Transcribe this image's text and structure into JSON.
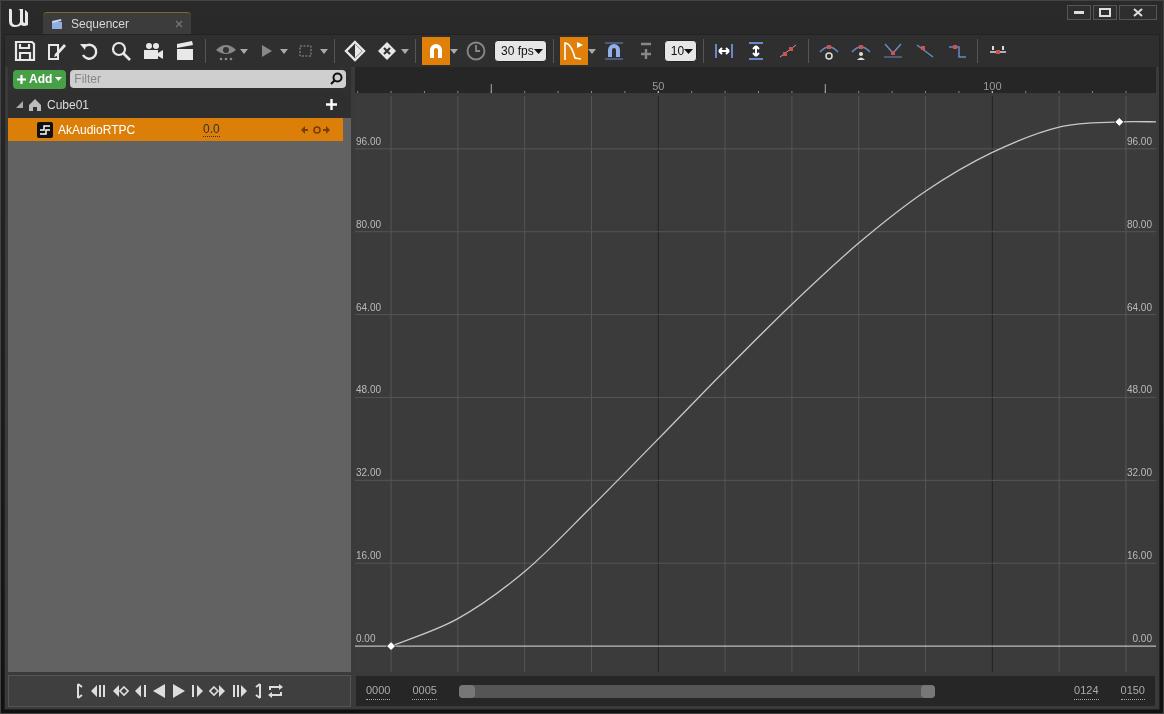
{
  "tab": {
    "title": "Sequencer"
  },
  "toolbar": {
    "snap_on": true,
    "fps": "30 fps",
    "curve_editor_on": true,
    "snap_value": "10"
  },
  "filter": {
    "add_label": "Add",
    "placeholder": "Filter"
  },
  "tree": [
    {
      "label": "Cube01",
      "expanded": true,
      "selected": false,
      "children": [
        {
          "label": "AkAudioRTPC",
          "value": "0.0",
          "selected": true
        }
      ]
    }
  ],
  "graph": {
    "chart_data": {
      "type": "line",
      "x": [
        10,
        20,
        30,
        40,
        50,
        60,
        70,
        80,
        90,
        100,
        110,
        119,
        124.5
      ],
      "series": [
        {
          "color": "#c8c8c8",
          "values": [
            0,
            5.3,
            14.4,
            26.9,
            40,
            53.2,
            66,
            77.8,
            87.8,
            95.3,
            100.2,
            101.2,
            101.2
          ]
        }
      ],
      "grid": true,
      "xlim": [
        4.6,
        124.5
      ],
      "ylim": [
        -5,
        106.2
      ],
      "xticks": [
        50,
        100
      ],
      "yticks": [
        {
          "value": 0,
          "label": "0.00"
        },
        {
          "value": 16,
          "label": "16.00"
        },
        {
          "value": 32,
          "label": "32.00"
        },
        {
          "value": 48,
          "label": "48.00"
        },
        {
          "value": 64,
          "label": "64.00"
        },
        {
          "value": 80,
          "label": "80.00"
        },
        {
          "value": 96,
          "label": "96.00"
        }
      ]
    }
  },
  "range": {
    "start": "0000",
    "view_start": "0005",
    "view_end": "0124",
    "end": "0150"
  }
}
